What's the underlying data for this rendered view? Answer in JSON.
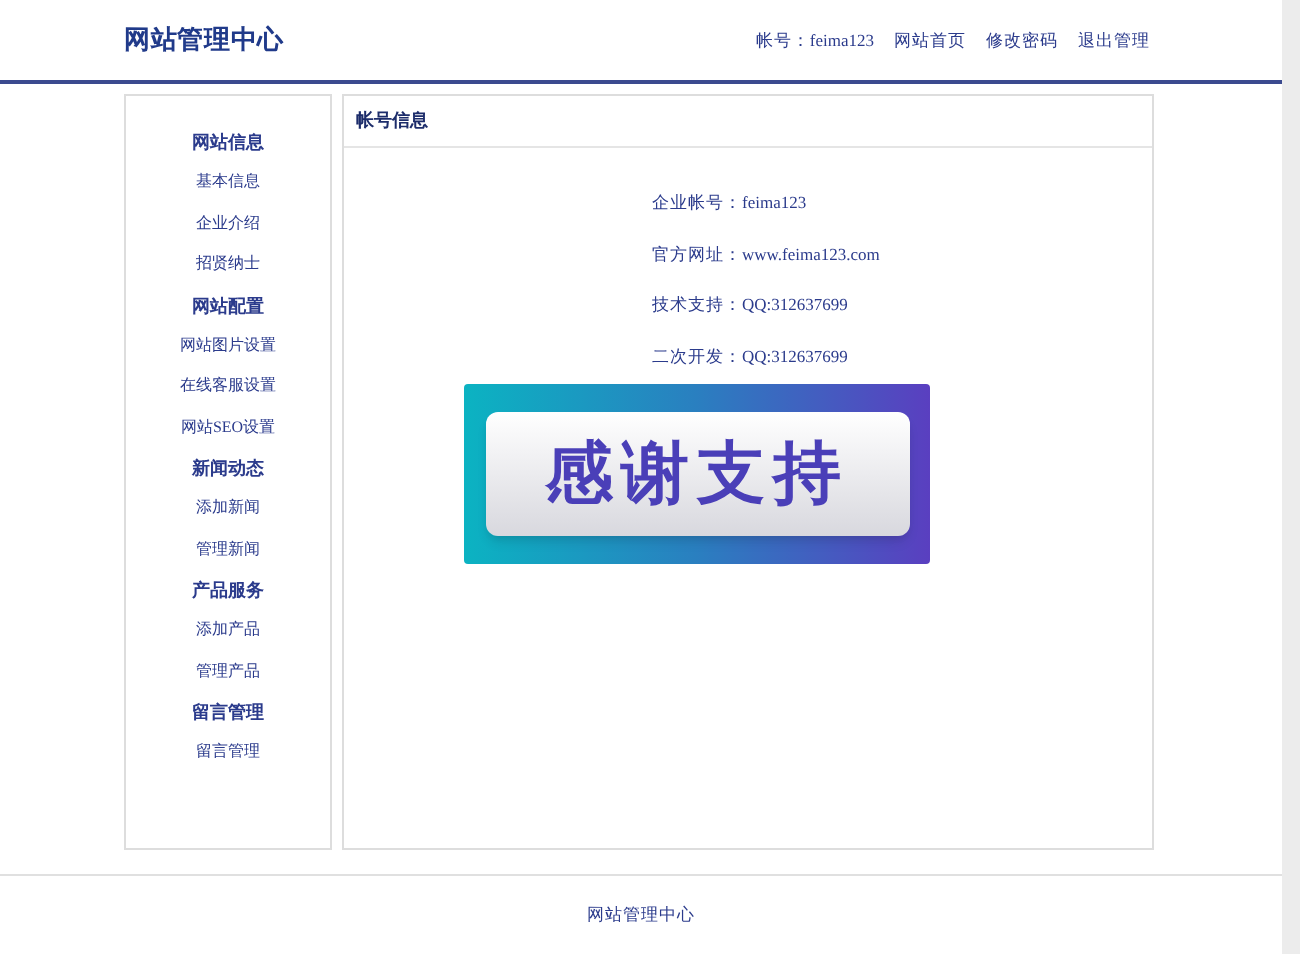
{
  "header": {
    "title": "网站管理中心",
    "account": "帐号：feima123",
    "links": [
      "网站首页",
      "修改密码",
      "退出管理"
    ]
  },
  "sidebar": {
    "groups": [
      {
        "title": "网站信息",
        "items": [
          "基本信息",
          "企业介绍",
          "招贤纳士"
        ]
      },
      {
        "title": "网站配置",
        "items": [
          "网站图片设置",
          "在线客服设置",
          "网站SEO设置"
        ]
      },
      {
        "title": "新闻动态",
        "items": [
          "添加新闻",
          "管理新闻"
        ]
      },
      {
        "title": "产品服务",
        "items": [
          "添加产品",
          "管理产品"
        ]
      },
      {
        "title": "留言管理",
        "items": [
          "留言管理"
        ]
      }
    ]
  },
  "panel": {
    "title": "帐号信息",
    "lines": [
      "企业帐号：feima123",
      "官方网址：www.feima123.com",
      "技术支持：QQ:312637699",
      "二次开发：QQ:312637699"
    ],
    "banner": "感谢支持"
  },
  "footer": "网站管理中心"
}
